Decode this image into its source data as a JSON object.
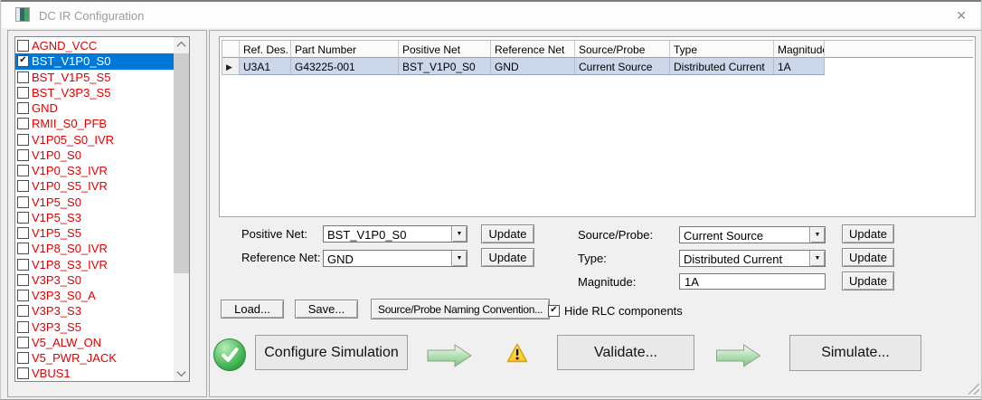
{
  "title_bar": {
    "title": "DC IR Configuration",
    "close": "✕"
  },
  "icons": {
    "check": "✔",
    "dropdown": "▼",
    "row_pointer": "▶"
  },
  "net_list": {
    "items": [
      {
        "label": "AGND_VCC",
        "checked": false,
        "selected": false
      },
      {
        "label": "BST_V1P0_S0",
        "checked": true,
        "selected": true
      },
      {
        "label": "BST_V1P5_S5",
        "checked": false,
        "selected": false
      },
      {
        "label": "BST_V3P3_S5",
        "checked": false,
        "selected": false
      },
      {
        "label": "GND",
        "checked": false,
        "selected": false
      },
      {
        "label": "RMII_S0_PFB",
        "checked": false,
        "selected": false
      },
      {
        "label": "V1P05_S0_IVR",
        "checked": false,
        "selected": false
      },
      {
        "label": "V1P0_S0",
        "checked": false,
        "selected": false
      },
      {
        "label": "V1P0_S3_IVR",
        "checked": false,
        "selected": false
      },
      {
        "label": "V1P0_S5_IVR",
        "checked": false,
        "selected": false
      },
      {
        "label": "V1P5_S0",
        "checked": false,
        "selected": false
      },
      {
        "label": "V1P5_S3",
        "checked": false,
        "selected": false
      },
      {
        "label": "V1P5_S5",
        "checked": false,
        "selected": false
      },
      {
        "label": "V1P8_S0_IVR",
        "checked": false,
        "selected": false
      },
      {
        "label": "V1P8_S3_IVR",
        "checked": false,
        "selected": false
      },
      {
        "label": "V3P3_S0",
        "checked": false,
        "selected": false
      },
      {
        "label": "V3P3_S0_A",
        "checked": false,
        "selected": false
      },
      {
        "label": "V3P3_S3",
        "checked": false,
        "selected": false
      },
      {
        "label": "V3P3_S5",
        "checked": false,
        "selected": false
      },
      {
        "label": "V5_ALW_ON",
        "checked": false,
        "selected": false
      },
      {
        "label": "V5_PWR_JACK",
        "checked": false,
        "selected": false
      },
      {
        "label": "VBUS1",
        "checked": false,
        "selected": false
      }
    ]
  },
  "grid": {
    "columns": [
      "Ref. Des.",
      "Part Number",
      "Positive Net",
      "Reference Net",
      "Source/Probe",
      "Type",
      "Magnitude"
    ],
    "rows": [
      [
        "U3A1",
        "G43225-001",
        "BST_V1P0_S0",
        "GND",
        "Current Source",
        "Distributed Current",
        "1A"
      ]
    ]
  },
  "fields": {
    "update_label": "Update",
    "positive_net": {
      "label": "Positive Net:",
      "value": "BST_V1P0_S0"
    },
    "reference_net": {
      "label": "Reference Net:",
      "value": "GND"
    },
    "source_probe": {
      "label": "Source/Probe:",
      "value": "Current Source"
    },
    "type": {
      "label": "Type:",
      "value": "Distributed Current"
    },
    "magnitude": {
      "label": "Magnitude:",
      "value": "1A"
    }
  },
  "actions": {
    "load": "Load...",
    "save": "Save...",
    "naming_convention": "Source/Probe Naming Convention...",
    "hide_rlc": {
      "label": "Hide RLC components",
      "checked": true
    },
    "configure": "Configure Simulation",
    "validate": "Validate...",
    "simulate": "Simulate..."
  },
  "colors": {
    "selection_blue": "#0078d7",
    "net_text_red": "#e00000",
    "row_highlight": "#cdd7ea",
    "success_green": "#2f9e40",
    "warning_yellow": "#fcc02e",
    "arrow_green": "#7cc47c"
  }
}
